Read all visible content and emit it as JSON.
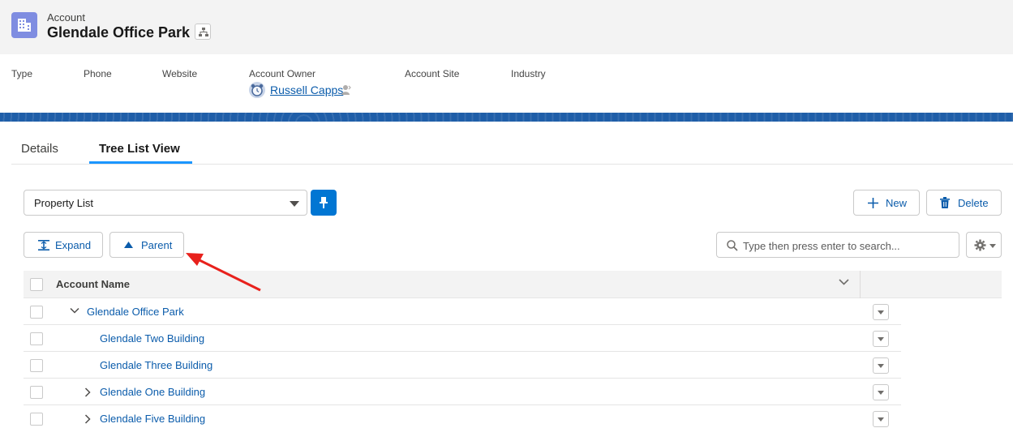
{
  "header": {
    "object_label": "Account",
    "record_title": "Glendale Office Park",
    "record_icon": "building-icon",
    "hierarchy_icon": "hierarchy-icon"
  },
  "highlights": {
    "fields": [
      "Type",
      "Phone",
      "Website",
      "Account Owner",
      "Account Site",
      "Industry"
    ],
    "owner_name": "Russell Capps"
  },
  "tabs": [
    {
      "label": "Details",
      "active": false
    },
    {
      "label": "Tree List View",
      "active": true
    }
  ],
  "toolbar": {
    "list_selected": "Property List",
    "new_label": "New",
    "delete_label": "Delete",
    "expand_label": "Expand",
    "parent_label": "Parent",
    "search_placeholder": "Type then press enter to search..."
  },
  "table": {
    "column_header": "Account Name",
    "rows": [
      {
        "name": "Glendale Office Park",
        "toggle": "expanded"
      },
      {
        "name": "Glendale Two Building",
        "toggle": "none"
      },
      {
        "name": "Glendale Three Building",
        "toggle": "none"
      },
      {
        "name": "Glendale One Building",
        "toggle": "collapsed"
      },
      {
        "name": "Glendale Five Building",
        "toggle": "collapsed"
      }
    ]
  },
  "annotation": {
    "color": "#e8211c",
    "icon": "red-arrow-annotation"
  },
  "colors": {
    "brand_blue": "#0176d3",
    "link_blue": "#0b5cab",
    "record_icon_bg": "#7f8de1",
    "tab_active": "#1b96ff"
  }
}
